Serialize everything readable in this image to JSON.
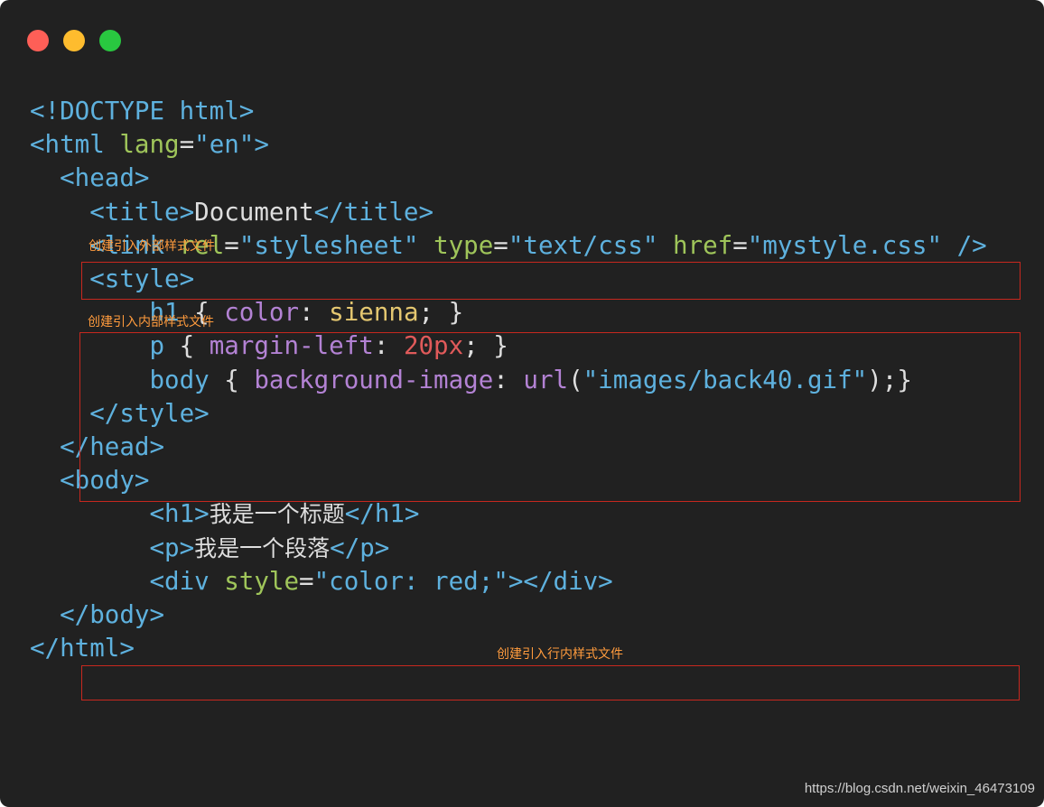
{
  "window": {
    "buttons": [
      {
        "name": "close",
        "color": "#fe5f57"
      },
      {
        "name": "minimize",
        "color": "#febc2e"
      },
      {
        "name": "zoom",
        "color": "#29c840"
      }
    ]
  },
  "colors": {
    "background": "#212121",
    "tag": "#5eb1de",
    "attribute": "#9fc55a",
    "string": "#5eb1de",
    "text": "#dedede",
    "css_property": "#b382d4",
    "css_value": "#e4c770",
    "number": "#e05a5a",
    "annotation": "#ff9b3d",
    "box": "#c7281f"
  },
  "code_lines": [
    [
      {
        "t": "<!DOCTYPE html>",
        "c": "tag"
      }
    ],
    [
      {
        "t": "<html ",
        "c": "tag"
      },
      {
        "t": "lang",
        "c": "attribute"
      },
      {
        "t": "=",
        "c": "text"
      },
      {
        "t": "\"en\"",
        "c": "string"
      },
      {
        "t": ">",
        "c": "tag"
      }
    ],
    [
      {
        "t": "  ",
        "c": "text"
      },
      {
        "t": "<head>",
        "c": "tag"
      }
    ],
    [
      {
        "t": "    ",
        "c": "text"
      },
      {
        "t": "<title>",
        "c": "tag"
      },
      {
        "t": "Document",
        "c": "text"
      },
      {
        "t": "</title>",
        "c": "tag"
      }
    ],
    [
      {
        "t": "    ",
        "c": "text"
      },
      {
        "t": "<link ",
        "c": "tag"
      },
      {
        "t": "rel",
        "c": "attribute"
      },
      {
        "t": "=",
        "c": "text"
      },
      {
        "t": "\"stylesheet\"",
        "c": "string"
      },
      {
        "t": " ",
        "c": "text"
      },
      {
        "t": "type",
        "c": "attribute"
      },
      {
        "t": "=",
        "c": "text"
      },
      {
        "t": "\"text/css\"",
        "c": "string"
      },
      {
        "t": " ",
        "c": "text"
      },
      {
        "t": "href",
        "c": "attribute"
      },
      {
        "t": "=",
        "c": "text"
      },
      {
        "t": "\"mystyle.css\"",
        "c": "string"
      },
      {
        "t": " />",
        "c": "tag"
      }
    ],
    [
      {
        "t": "    ",
        "c": "text"
      },
      {
        "t": "<style>",
        "c": "tag"
      }
    ],
    [
      {
        "t": "        ",
        "c": "text"
      },
      {
        "t": "h1",
        "c": "tag"
      },
      {
        "t": " { ",
        "c": "text"
      },
      {
        "t": "color",
        "c": "css_property"
      },
      {
        "t": ": ",
        "c": "text"
      },
      {
        "t": "sienna",
        "c": "css_value"
      },
      {
        "t": "; }",
        "c": "text"
      }
    ],
    [
      {
        "t": "        ",
        "c": "text"
      },
      {
        "t": "p",
        "c": "tag"
      },
      {
        "t": " { ",
        "c": "text"
      },
      {
        "t": "margin-left",
        "c": "css_property"
      },
      {
        "t": ": ",
        "c": "text"
      },
      {
        "t": "20px",
        "c": "number"
      },
      {
        "t": "; }",
        "c": "text"
      }
    ],
    [
      {
        "t": "        ",
        "c": "text"
      },
      {
        "t": "body",
        "c": "tag"
      },
      {
        "t": " { ",
        "c": "text"
      },
      {
        "t": "background-image",
        "c": "css_property"
      },
      {
        "t": ": ",
        "c": "text"
      },
      {
        "t": "url",
        "c": "css_property"
      },
      {
        "t": "(",
        "c": "text"
      },
      {
        "t": "\"images/back40.gif\"",
        "c": "string"
      },
      {
        "t": ");}",
        "c": "text"
      }
    ],
    [
      {
        "t": "    ",
        "c": "text"
      },
      {
        "t": "</style>",
        "c": "tag"
      }
    ],
    [
      {
        "t": "  ",
        "c": "text"
      },
      {
        "t": "</head>",
        "c": "tag"
      }
    ],
    [
      {
        "t": "  ",
        "c": "text"
      },
      {
        "t": "<body>",
        "c": "tag"
      }
    ],
    [
      {
        "t": "        ",
        "c": "text"
      },
      {
        "t": "<h1>",
        "c": "tag"
      },
      {
        "t": "我是一个标题",
        "c": "text",
        "cjk": true
      },
      {
        "t": "</h1>",
        "c": "tag"
      }
    ],
    [
      {
        "t": "        ",
        "c": "text"
      },
      {
        "t": "<p>",
        "c": "tag"
      },
      {
        "t": "我是一个段落",
        "c": "text",
        "cjk": true
      },
      {
        "t": "</p>",
        "c": "tag"
      }
    ],
    [
      {
        "t": "        ",
        "c": "text"
      },
      {
        "t": "<div ",
        "c": "tag"
      },
      {
        "t": "style",
        "c": "attribute"
      },
      {
        "t": "=",
        "c": "text"
      },
      {
        "t": "\"color: red;\"",
        "c": "string"
      },
      {
        "t": "></div>",
        "c": "tag"
      }
    ],
    [
      {
        "t": "  ",
        "c": "text"
      },
      {
        "t": "</body>",
        "c": "tag"
      }
    ],
    [
      {
        "t": "</html>",
        "c": "tag"
      }
    ]
  ],
  "annotations": {
    "external": "创建引入外部样式文件",
    "internal": "创建引入内部样式文件",
    "inline": "创建引入行内样式文件"
  },
  "watermark": "https://blog.csdn.net/weixin_46473109"
}
